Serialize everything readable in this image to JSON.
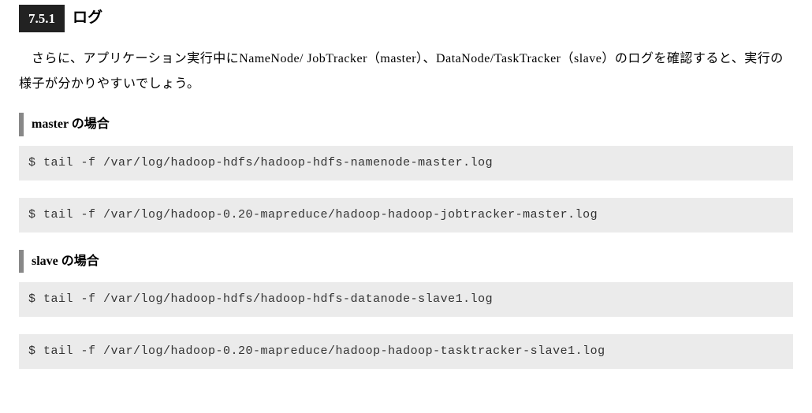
{
  "section": {
    "number": "7.5.1",
    "title": "ログ"
  },
  "paragraph": "さらに、アプリケーション実行中にNameNode/ JobTracker（master）、DataNode/TaskTracker（slave）のログを確認すると、実行の様子が分かりやすいでしょう。",
  "subsections": [
    {
      "heading": "master の場合",
      "code_blocks": [
        "$ tail -f /var/log/hadoop-hdfs/hadoop-hdfs-namenode-master.log",
        "$ tail -f /var/log/hadoop-0.20-mapreduce/hadoop-hadoop-jobtracker-master.log"
      ]
    },
    {
      "heading": "slave の場合",
      "code_blocks": [
        "$ tail -f /var/log/hadoop-hdfs/hadoop-hdfs-datanode-slave1.log",
        "$ tail -f /var/log/hadoop-0.20-mapreduce/hadoop-hadoop-tasktracker-slave1.log"
      ]
    }
  ]
}
